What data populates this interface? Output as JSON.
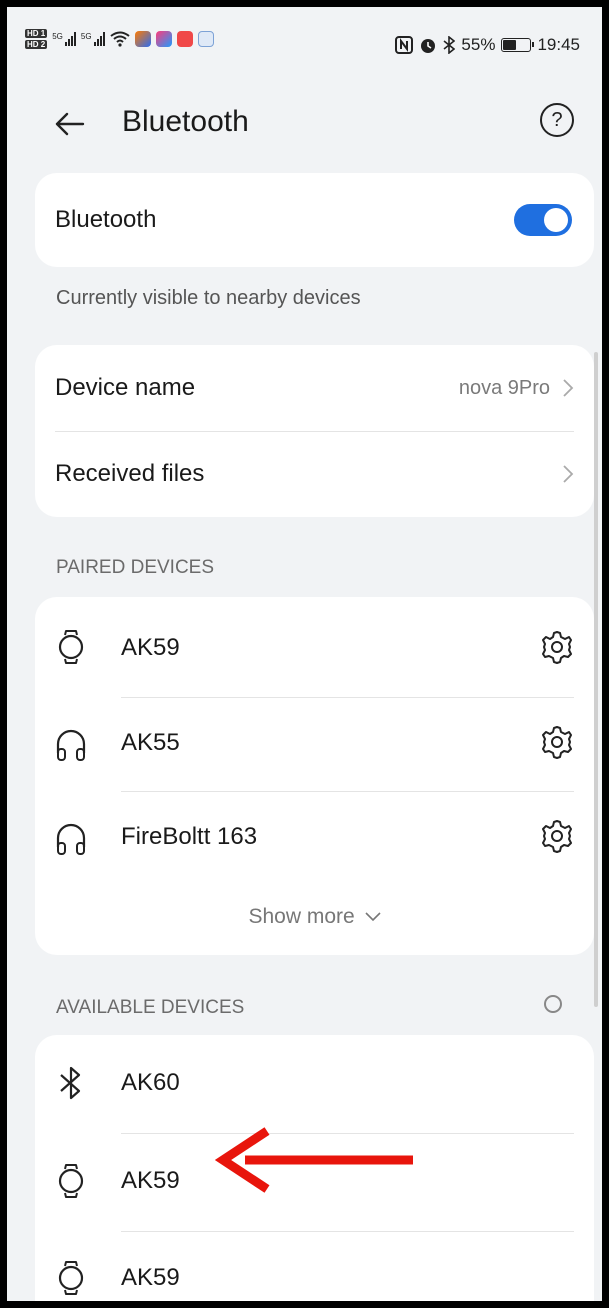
{
  "status_bar": {
    "battery": "55%",
    "battery_level": 0.55,
    "time": "19:45",
    "network_1": "5G",
    "network_2": "5G"
  },
  "header": {
    "title": "Bluetooth",
    "help_symbol": "?"
  },
  "bluetooth_toggle": {
    "label": "Bluetooth",
    "on": true,
    "accent_color": "#1f6fe0"
  },
  "visibility_note": "Currently visible to nearby devices",
  "device_settings": {
    "device_name_label": "Device name",
    "device_name_value": "nova 9Pro",
    "received_files_label": "Received files"
  },
  "paired": {
    "header": "PAIRED DEVICES",
    "devices": [
      {
        "name": "AK59",
        "icon": "watch-icon"
      },
      {
        "name": "AK55",
        "icon": "headphones-icon"
      },
      {
        "name": "FireBoltt 163",
        "icon": "headphones-icon"
      }
    ],
    "show_more": "Show more"
  },
  "available": {
    "header": "AVAILABLE DEVICES",
    "devices": [
      {
        "name": "AK60",
        "icon": "bluetooth-icon"
      },
      {
        "name": "AK59",
        "icon": "watch-icon"
      },
      {
        "name": "AK59",
        "icon": "watch-icon"
      }
    ]
  },
  "annotation": {
    "color": "#e8150c"
  }
}
